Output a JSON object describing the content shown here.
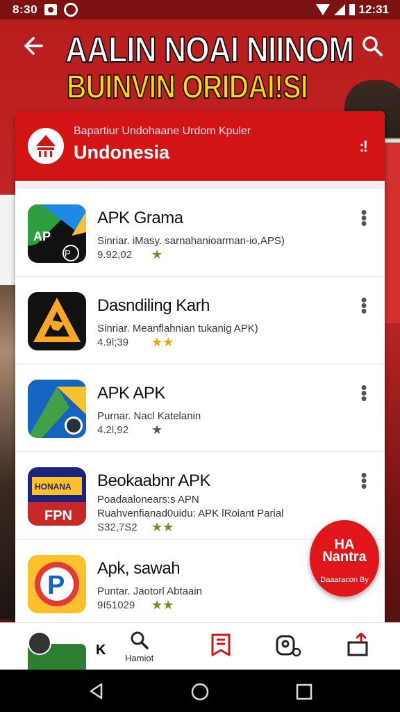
{
  "status_bar": {
    "time_left": "8:30",
    "time_right": "12:31"
  },
  "hero": {
    "title_line1": "AALIN NOAI NIINOM",
    "title_line2": "BUINVIN ORIDAI!SI"
  },
  "card": {
    "subtitle": "Bapartiur Undohaane Urdom Kpuler",
    "title": "Undonesia",
    "menu_label": ":!"
  },
  "apps": [
    {
      "name": "APK Grama",
      "desc": "Sinriar. iMasy. sarnahanioarman-io,APS)",
      "desc2": "",
      "meta": "9.92,02",
      "icon": "apk-grama-icon",
      "icon_label": "AP",
      "icon_colors": [
        "#1e88e5",
        "#fbc02d",
        "#e53935",
        "#111111"
      ]
    },
    {
      "name": "Dasndiling Karh",
      "desc": "Sinriar. Meanflahnian tukanig APK)",
      "desc2": "",
      "meta": "4.9l;39",
      "icon": "dasndiling-karh-icon",
      "icon_label": "4",
      "icon_colors": [
        "#111111",
        "#f9a825"
      ]
    },
    {
      "name": "APK APK",
      "desc": "Purnar. Nacl Katelanin",
      "desc2": "",
      "meta": "4.2l,92",
      "icon": "apk-apk-icon",
      "icon_label": "",
      "icon_colors": [
        "#1565c0",
        "#43a047",
        "#fbc02d",
        "#e53935"
      ]
    },
    {
      "name": "Beokaabnr APK",
      "desc": "Poadaalonears:s APN",
      "desc2": "Ruahvenfianad0uidu: APK  lRoiant Parial",
      "meta": "S32,7S2",
      "icon": "beokaabnr-apk-icon",
      "icon_label": "FPN",
      "icon_colors": [
        "#1a237e",
        "#fbc02d",
        "#e53935"
      ]
    },
    {
      "name": "Apk, sawah",
      "desc": "Puntar. Jaotorl Abtaain",
      "desc2": "",
      "meta": "9I51029",
      "icon": "apk-sawah-icon",
      "icon_label": "P",
      "icon_colors": [
        "#fbc02d",
        "#e53935",
        "#1565c0"
      ]
    }
  ],
  "fab": {
    "line1": "HA",
    "line1b": "Nantra",
    "line2": "Daaaracon By"
  },
  "bottom_nav": {
    "skip": "K",
    "search_label": "Hamiot"
  },
  "colors": {
    "primary_red": "#d31414",
    "status_bar": "#7d1212"
  }
}
